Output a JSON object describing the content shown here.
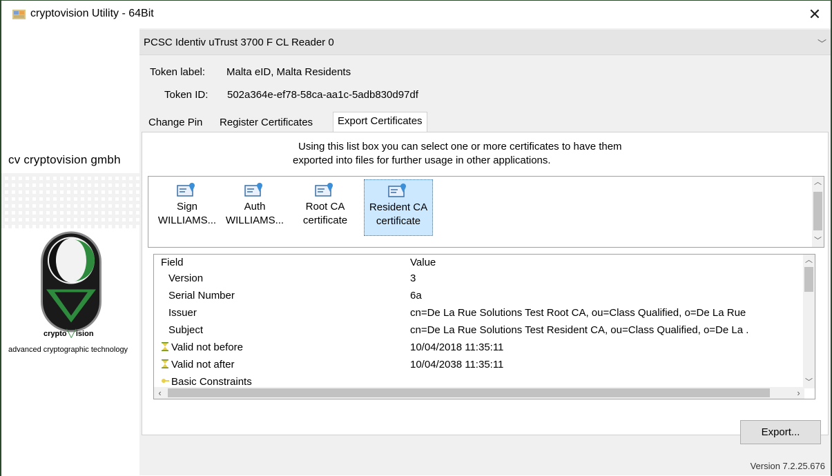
{
  "window": {
    "title": "cryptovision Utility - 64Bit",
    "close_glyph": "✕"
  },
  "brand": {
    "company": "cv cryptovision gmbh",
    "logo_word_prefix": "crypto",
    "logo_word_suffix": "ision",
    "tagline": "advanced cryptographic technology"
  },
  "reader": {
    "selected": "PCSC Identiv uTrust 3700 F CL Reader 0",
    "chevron": "﹀"
  },
  "token": {
    "label_caption": "Token label:",
    "label_value": "Malta eID, Malta Residents",
    "id_caption": "Token ID:",
    "id_value": "502a364e-ef78-58ca-aa1c-5adb830d97df"
  },
  "tabs": [
    {
      "label": "Change Pin",
      "active": false
    },
    {
      "label": "Register Certificates",
      "active": false
    },
    {
      "label": "Export Certificates",
      "active": true
    }
  ],
  "export_tab": {
    "hint_line1": "Using this list box you can select one or more certificates to have them",
    "hint_line2": "exported into files for further usage in other applications.",
    "certificates": [
      {
        "line1": "Sign",
        "line2": "WILLIAMS...",
        "selected": false
      },
      {
        "line1": "Auth",
        "line2": "WILLIAMS...",
        "selected": false
      },
      {
        "line1": "Root CA",
        "line2": "certificate",
        "selected": false
      },
      {
        "line1": "Resident CA",
        "line2": "certificate",
        "selected": true
      }
    ],
    "details": {
      "columns": [
        "Field",
        "Value"
      ],
      "rows": [
        {
          "field": "Version",
          "value": "3",
          "icon": ""
        },
        {
          "field": "Serial Number",
          "value": "6a",
          "icon": ""
        },
        {
          "field": "Issuer",
          "value": "cn=De La Rue Solutions Test Root CA, ou=Class Qualified, o=De La Rue",
          "icon": ""
        },
        {
          "field": "Subject",
          "value": "cn=De La Rue Solutions Test Resident CA, ou=Class Qualified, o=De La .",
          "icon": ""
        },
        {
          "field": "Valid not before",
          "value": "10/04/2018 11:35:11",
          "icon": "hourglass-icon"
        },
        {
          "field": "Valid not after",
          "value": "10/04/2038 11:35:11",
          "icon": "hourglass-icon"
        },
        {
          "field": "Basic Constraints",
          "value": "",
          "icon": "key-icon"
        }
      ]
    },
    "export_button": "Export..."
  },
  "version": "Version 7.2.25.676",
  "colors": {
    "selection": "#cce8ff",
    "panel_bg": "#f0f0f0",
    "logo_green": "#2e8b3d",
    "logo_dark": "#1a1a1a"
  }
}
